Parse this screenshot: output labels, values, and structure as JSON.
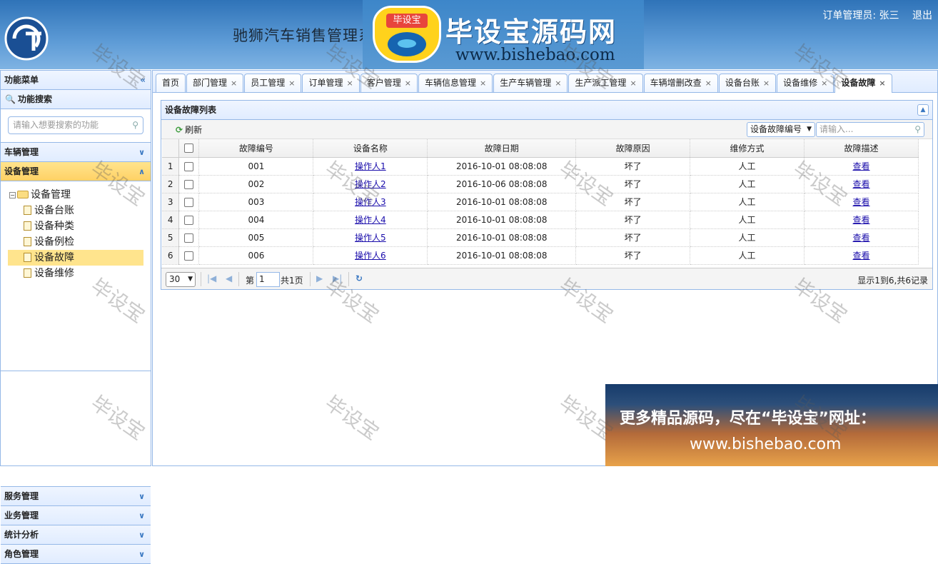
{
  "header": {
    "app_title": "驰狮汽车销售管理系统",
    "user_label": "订单管理员: 张三",
    "logout": "退出",
    "banner_title": "毕设宝源码网",
    "banner_url": "www.bishebao.com",
    "banner_badge": "毕设宝"
  },
  "sidebar": {
    "menu_title": "功能菜单",
    "search_title": "功能搜索",
    "search_placeholder": "请输入想要搜索的功能",
    "groups": [
      {
        "label": "车辆管理",
        "active": false
      },
      {
        "label": "设备管理",
        "active": true
      },
      {
        "label": "服务管理",
        "active": false
      },
      {
        "label": "业务管理",
        "active": false
      },
      {
        "label": "统计分析",
        "active": false
      },
      {
        "label": "角色管理",
        "active": false
      }
    ],
    "tree": {
      "root": "设备管理",
      "children": [
        "设备台账",
        "设备种类",
        "设备例检",
        "设备故障",
        "设备维修"
      ],
      "selected": "设备故障"
    }
  },
  "tabs": [
    "首页",
    "部门管理",
    "员工管理",
    "订单管理",
    "客户管理",
    "车辆信息管理",
    "生产车辆管理",
    "生产派工管理",
    "车辆增删改查",
    "设备台账",
    "设备维修",
    "设备故障"
  ],
  "active_tab": "设备故障",
  "grid": {
    "title": "设备故障列表",
    "refresh_label": "刷新",
    "search_field": "设备故障编号",
    "search_placeholder": "请输入...",
    "columns": [
      "故障编号",
      "设备名称",
      "故障日期",
      "故障原因",
      "维修方式",
      "故障描述"
    ],
    "rows": [
      [
        "1",
        "001",
        "操作人1",
        "2016-10-01 08:08:08",
        "坏了",
        "人工",
        "查看"
      ],
      [
        "2",
        "002",
        "操作人2",
        "2016-10-06 08:08:08",
        "坏了",
        "人工",
        "查看"
      ],
      [
        "3",
        "003",
        "操作人3",
        "2016-10-01 08:08:08",
        "坏了",
        "人工",
        "查看"
      ],
      [
        "4",
        "004",
        "操作人4",
        "2016-10-01 08:08:08",
        "坏了",
        "人工",
        "查看"
      ],
      [
        "5",
        "005",
        "操作人5",
        "2016-10-01 08:08:08",
        "坏了",
        "人工",
        "查看"
      ],
      [
        "6",
        "006",
        "操作人6",
        "2016-10-01 08:08:08",
        "坏了",
        "人工",
        "查看"
      ]
    ],
    "pager": {
      "page_size": "30",
      "page_prefix": "第",
      "page_value": "1",
      "page_total": "共1页",
      "info": "显示1到6,共6记录"
    }
  },
  "promo": {
    "line1": "更多精品源码，尽在“毕设宝”网址：",
    "line2": "www.bishebao.com"
  },
  "watermark": "毕设宝"
}
